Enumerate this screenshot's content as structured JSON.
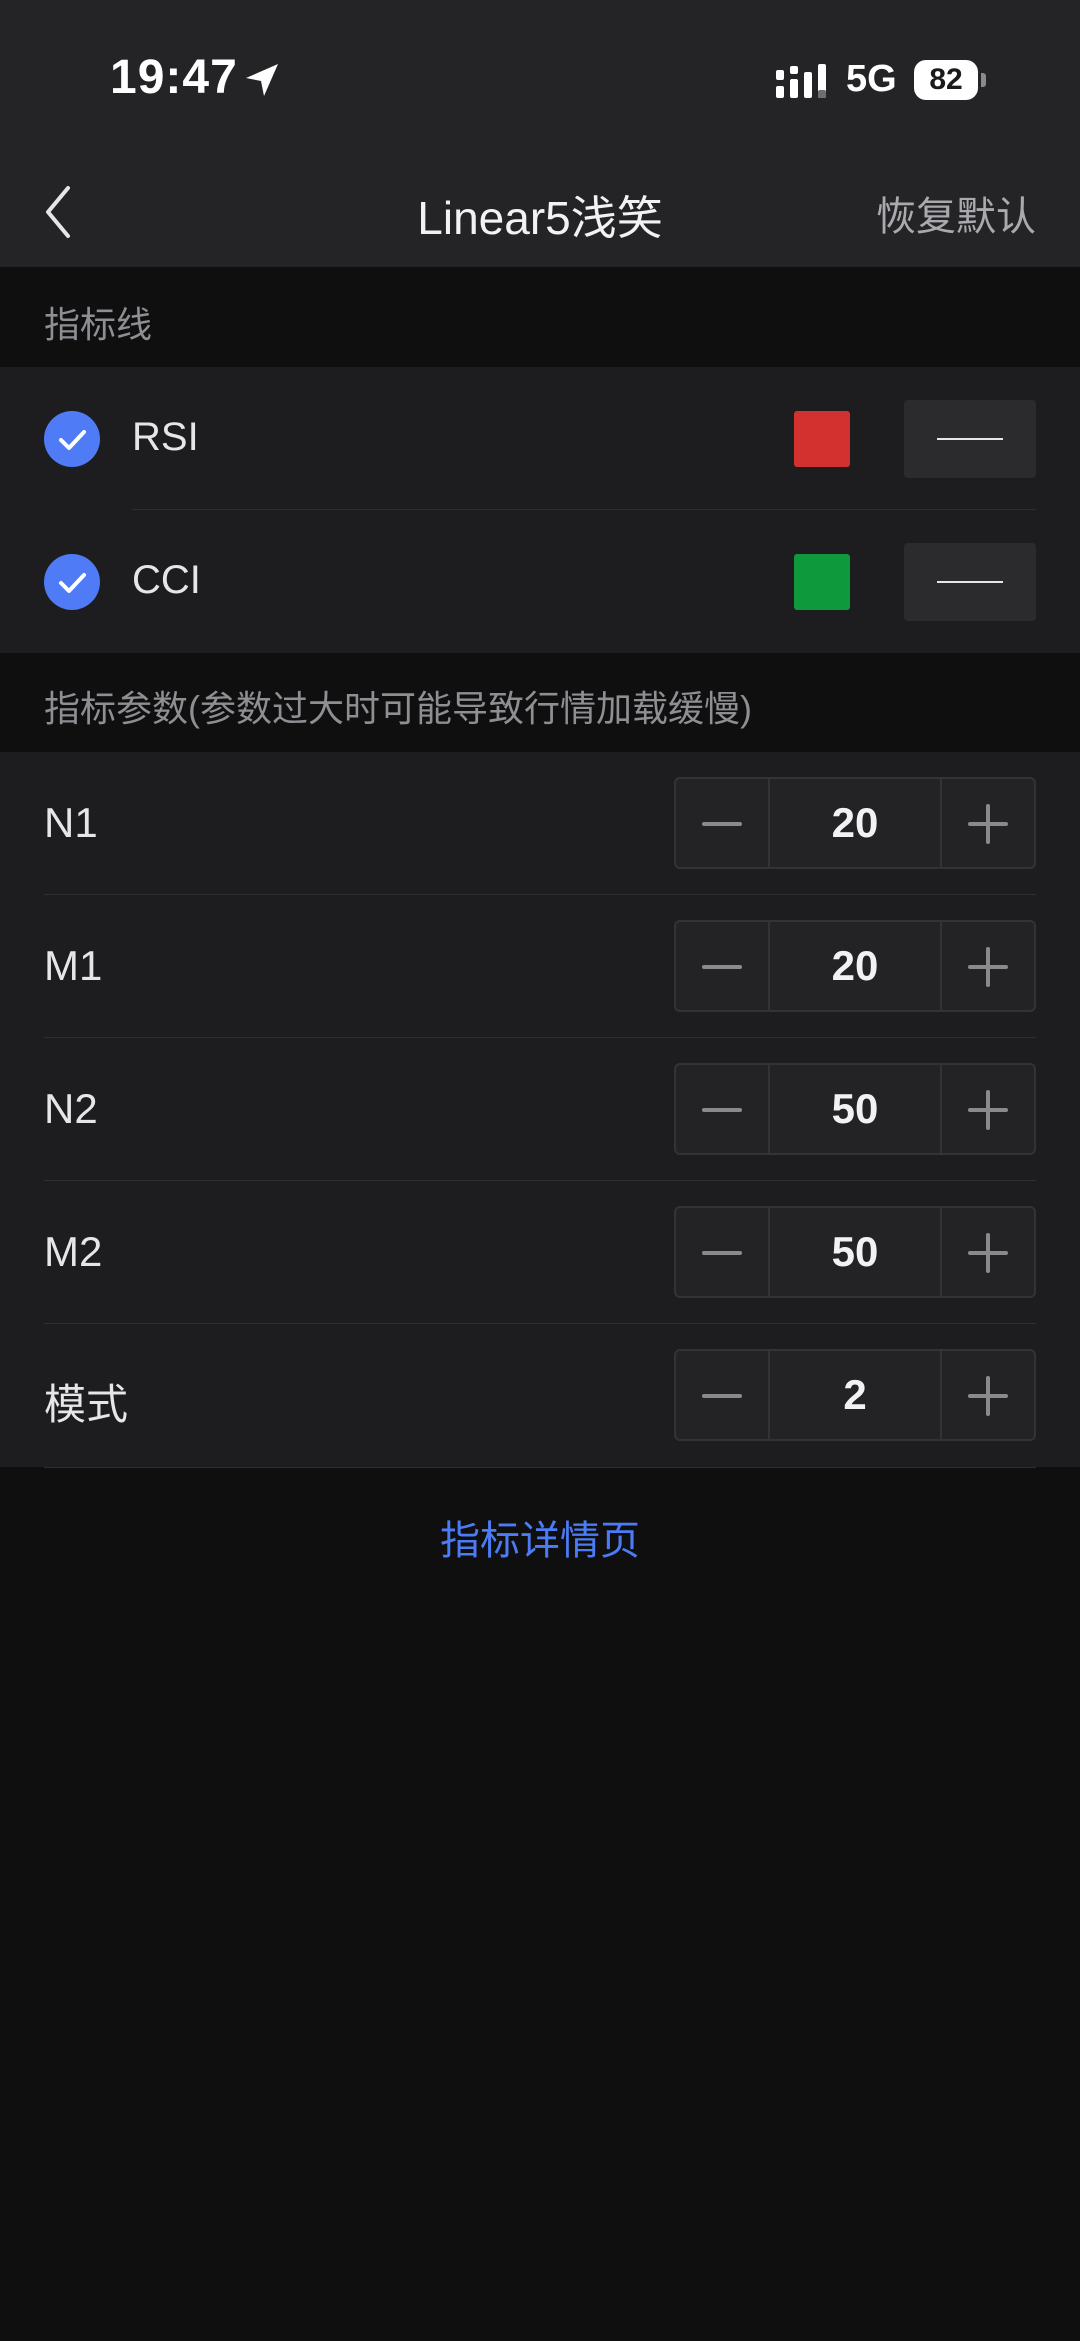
{
  "status_bar": {
    "time": "19:47",
    "network": "5G",
    "battery": "82",
    "icons": [
      "location-arrow-icon",
      "cellular-signal-icon",
      "battery-icon"
    ]
  },
  "nav": {
    "back_icon": "chevron-left-icon",
    "title": "Linear5浅笑",
    "reset_label": "恢复默认"
  },
  "lines_section": {
    "header": "指标线",
    "items": [
      {
        "label": "RSI",
        "checked": true,
        "color": "#d33030"
      },
      {
        "label": "CCI",
        "checked": true,
        "color": "#0e9a3c"
      }
    ]
  },
  "params_section": {
    "header": "指标参数(参数过大时可能导致行情加载缓慢)",
    "items": [
      {
        "label": "N1",
        "value": "20"
      },
      {
        "label": "M1",
        "value": "20"
      },
      {
        "label": "N2",
        "value": "50"
      },
      {
        "label": "M2",
        "value": "50"
      },
      {
        "label": "模式",
        "value": "2"
      }
    ]
  },
  "detail_link": "指标详情页",
  "colors": {
    "accent": "#4f7cf6",
    "link": "#4b7cf5",
    "background": "#0f0f10",
    "panel": "#1d1d1f"
  }
}
